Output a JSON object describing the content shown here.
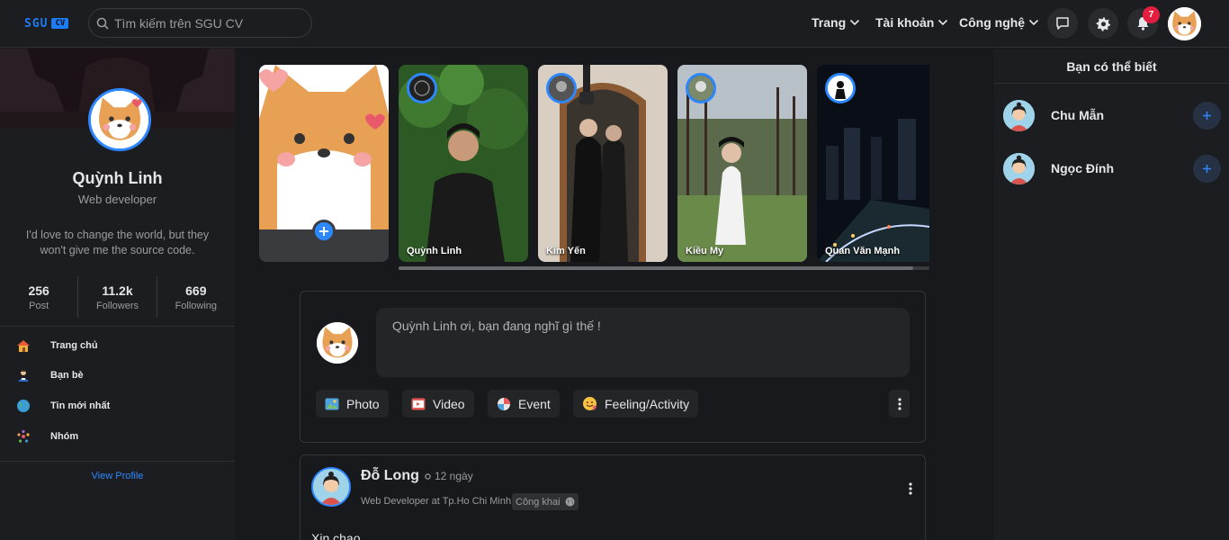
{
  "brand": {
    "logo_main": "SGU",
    "logo_tag": "CV"
  },
  "search": {
    "placeholder": "Tìm kiếm trên SGU CV"
  },
  "nav": [
    {
      "label": "Trang"
    },
    {
      "label": "Tài khoản"
    },
    {
      "label": "Công nghệ"
    }
  ],
  "notifications": {
    "count": "7"
  },
  "colors": {
    "accent": "#2d88ff",
    "background": "#18191c",
    "panel": "#1c1d20",
    "badge": "#e41e3f"
  },
  "profile": {
    "name": "Quỳnh Linh",
    "role": "Web developer",
    "bio": "I'd love to change the world, but they won't give me the source code.",
    "stats": [
      {
        "value": "256",
        "label": "Post"
      },
      {
        "value": "11.2k",
        "label": "Followers"
      },
      {
        "value": "669",
        "label": "Following"
      }
    ],
    "menu": [
      {
        "label": "Trang chủ",
        "icon": "home-icon"
      },
      {
        "label": "Bạn bè",
        "icon": "friends-icon"
      },
      {
        "label": "Tin mới nhất",
        "icon": "globe-icon"
      },
      {
        "label": "Nhóm",
        "icon": "group-icon"
      }
    ],
    "view_profile": "View Profile"
  },
  "stories": [
    {
      "name": "Quỳnh Linh"
    },
    {
      "name": "Kim Yến"
    },
    {
      "name": "Kiều My"
    },
    {
      "name": "Quan Văn Mạnh"
    }
  ],
  "composer": {
    "prompt": "Quỳnh  Linh ơi, bạn đang nghĩ gì thế !",
    "actions": [
      {
        "label": "Photo",
        "icon": "photo-icon"
      },
      {
        "label": "Video",
        "icon": "video-icon"
      },
      {
        "label": "Event",
        "icon": "event-icon"
      },
      {
        "label": "Feeling/Activity",
        "icon": "feeling-icon"
      }
    ]
  },
  "post": {
    "author": "Đỗ Long",
    "time": "12 ngày",
    "subtitle": "Web Developer at Tp.Ho Chi Minh",
    "privacy": "Công khai",
    "text": "Xin chao"
  },
  "suggestions": {
    "title": "Bạn có thể biết",
    "people": [
      {
        "name": "Chu Mẫn"
      },
      {
        "name": "Ngọc Đính"
      }
    ]
  }
}
